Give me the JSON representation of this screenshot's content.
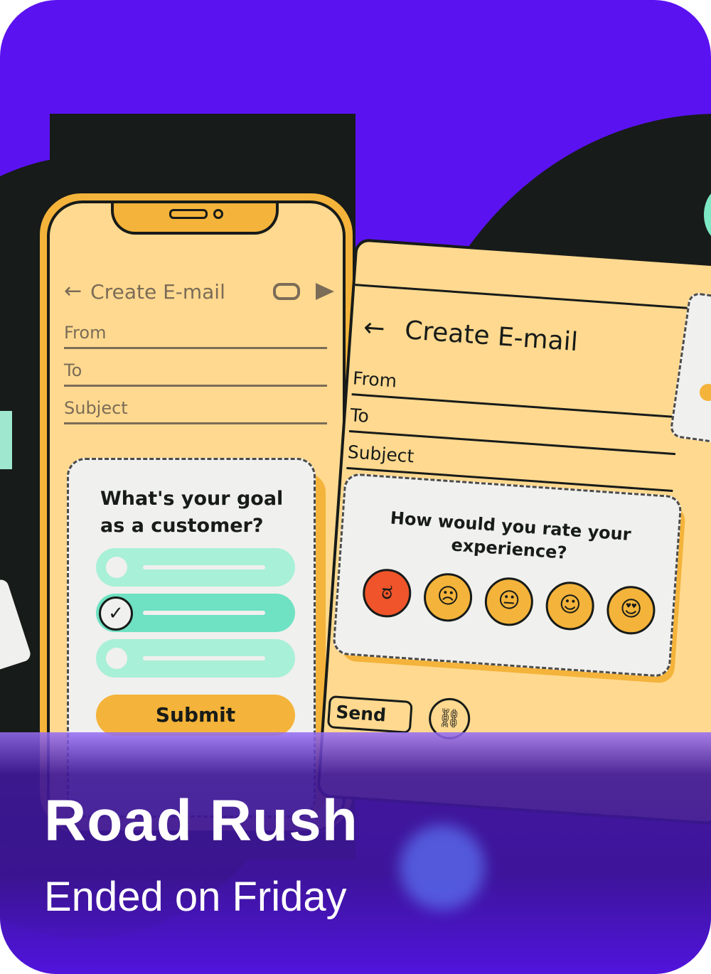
{
  "card": {
    "title": "Road Rush",
    "status": "Ended on Friday",
    "colors": {
      "background": "#5b12f0",
      "dark": "#171b19",
      "yellow": "#f4b33a",
      "teal": "#6ee2c2"
    }
  },
  "phone": {
    "header_title": "Create E-mail",
    "fields": [
      "From",
      "To",
      "Subject"
    ],
    "survey_question": "What's your goal as a customer?",
    "submit_label": "Submit",
    "icons": [
      "arrow-left-icon",
      "paperclip-icon",
      "send-icon"
    ]
  },
  "panel": {
    "header_title": "Create E-mail",
    "fields": [
      "From",
      "To",
      "Subject"
    ],
    "rating_question": "How would you rate your experience?",
    "emojis": [
      "angry-face-icon",
      "sad-face-icon",
      "neutral-face-icon",
      "smile-face-icon",
      "heart-eyes-face-icon"
    ],
    "send_label": "Send"
  }
}
